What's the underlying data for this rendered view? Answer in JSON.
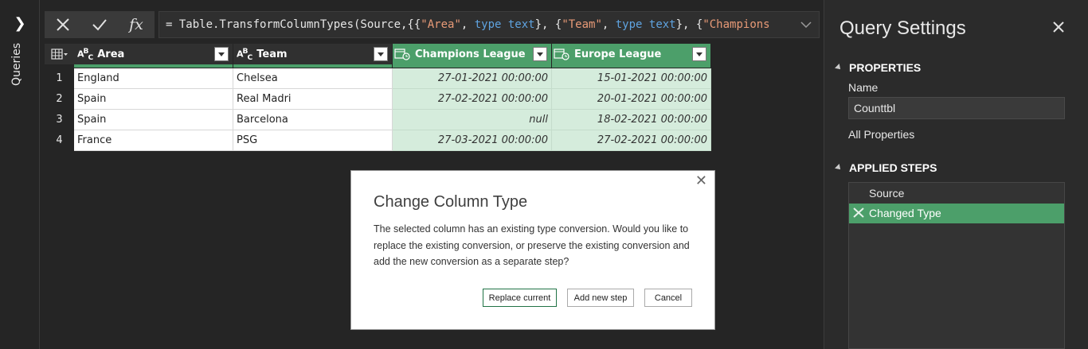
{
  "rail": {
    "label": "Queries"
  },
  "formula": {
    "prefix": "= Table.TransformColumnTypes(Source,{{",
    "s1": "\"Area\"",
    "sep1": ", ",
    "k1": "type text",
    "sep2": "}, {",
    "s2": "\"Team\"",
    "sep3": ", ",
    "k2": "type text",
    "sep4": "}, {",
    "s3": "\"Champions"
  },
  "grid": {
    "columns": [
      {
        "name": "Area",
        "type_icon": "ABC"
      },
      {
        "name": "Team",
        "type_icon": "ABC"
      },
      {
        "name": "Champions League",
        "type_icon": "datetime"
      },
      {
        "name": "Europe League",
        "type_icon": "datetime"
      }
    ],
    "rows": [
      {
        "num": "1",
        "area": "England",
        "team": "Chelsea",
        "cl": "27-01-2021 00:00:00",
        "el": "15-01-2021 00:00:00"
      },
      {
        "num": "2",
        "area": "Spain",
        "team": "Real Madri",
        "cl": "27-02-2021 00:00:00",
        "el": "20-01-2021 00:00:00"
      },
      {
        "num": "3",
        "area": "Spain",
        "team": "Barcelona",
        "cl": "null",
        "el": "18-02-2021 00:00:00"
      },
      {
        "num": "4",
        "area": "France",
        "team": "PSG",
        "cl": "27-03-2021 00:00:00",
        "el": "27-02-2021 00:00:00"
      }
    ]
  },
  "dialog": {
    "title": "Change Column Type",
    "body": "The selected column has an existing type conversion. Would you like to replace the existing conversion, or preserve the existing conversion and add the new conversion as a separate step?",
    "buttons": {
      "replace": "Replace current",
      "add": "Add new step",
      "cancel": "Cancel"
    }
  },
  "pane": {
    "title": "Query Settings",
    "properties_header": "PROPERTIES",
    "name_label": "Name",
    "name_value": "Counttbl",
    "all_properties": "All Properties",
    "steps_header": "APPLIED STEPS",
    "steps": [
      "Source",
      "Changed Type"
    ]
  },
  "colors": {
    "accent_green": "#4c9f6a",
    "cell_green": "#d5ecdc",
    "dark_bg": "#252525"
  }
}
